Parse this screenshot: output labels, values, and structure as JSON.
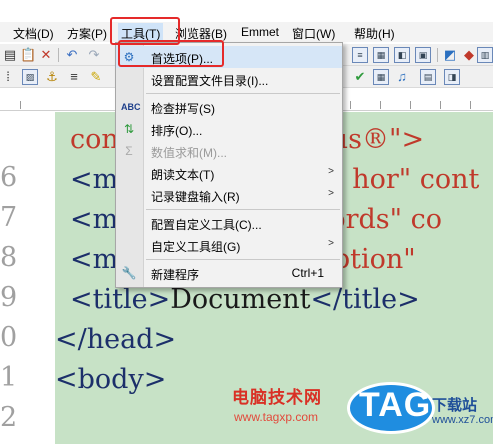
{
  "menubar": {
    "items": [
      {
        "label": "文档(D)"
      },
      {
        "label": "方案(P)"
      },
      {
        "label": "工具(T)"
      },
      {
        "label": "浏览器(B)"
      },
      {
        "label": "Emmet"
      },
      {
        "label": "窗口(W)"
      },
      {
        "label": "帮助(H)"
      }
    ],
    "active": "工具(T)"
  },
  "tools_menu": {
    "items": [
      {
        "label": "首选项(P)...",
        "icon": "gear-icon",
        "enabled": true
      },
      {
        "label": "设置配置文件目录(I)...",
        "enabled": true
      },
      {
        "label": "检查拼写(S)",
        "icon": "spellcheck-icon",
        "enabled": true
      },
      {
        "label": "排序(O)...",
        "icon": "sort-icon",
        "enabled": true
      },
      {
        "label": "数值求和(M)...",
        "icon": "sum-icon",
        "enabled": false
      },
      {
        "label": "朗读文本(T)",
        "submenu": true,
        "enabled": true
      },
      {
        "label": "记录键盘输入(R)",
        "submenu": true,
        "enabled": true
      },
      {
        "label": "配置自定义工具(C)...",
        "enabled": true
      },
      {
        "label": "自定义工具组(G)",
        "submenu": true,
        "enabled": true
      },
      {
        "label": "新建程序",
        "shortcut": "Ctrl+1",
        "icon": "wrench-icon",
        "enabled": true
      }
    ]
  },
  "editor": {
    "line_numbers": [
      "6",
      "7",
      "8",
      "9",
      "0",
      "1",
      "2"
    ],
    "lines": [
      {
        "segments": [
          {
            "text": "con",
            "c": "red"
          },
          {
            "text": "us®\">",
            "c": "red"
          }
        ]
      },
      {
        "segments": [
          {
            "text": "<me",
            "c": "tag"
          },
          {
            "text": "hor\" ",
            "c": "red"
          },
          {
            "text": "cont",
            "c": "red"
          }
        ]
      },
      {
        "segments": [
          {
            "text": "<me",
            "c": "tag"
          },
          {
            "text": "words\" ",
            "c": "red"
          },
          {
            "text": "co",
            "c": "red"
          }
        ]
      },
      {
        "segments": [
          {
            "text": "<me",
            "c": "tag"
          },
          {
            "text": "cription\"",
            "c": "red"
          }
        ]
      },
      {
        "segments": [
          {
            "text": "<title>",
            "c": "tag"
          },
          {
            "text": "Document",
            "c": "dk"
          },
          {
            "text": "</title>",
            "c": "tag"
          }
        ]
      },
      {
        "segments": [
          {
            "text": "</head>",
            "c": "tag"
          }
        ]
      },
      {
        "segments": [
          {
            "text": "<body>",
            "c": "tag"
          }
        ]
      }
    ]
  },
  "watermark": {
    "line1": "电脑技术网",
    "line2": "www.tagxp.com",
    "badge": "TAG",
    "side": "下载站",
    "url": "www.xz7.com"
  },
  "colors": {
    "highlight_box": "#e52a2a",
    "editor_bg": "#c7e2c6",
    "tag_blue": "#1c2f6a",
    "attr_red": "#c0392b"
  }
}
